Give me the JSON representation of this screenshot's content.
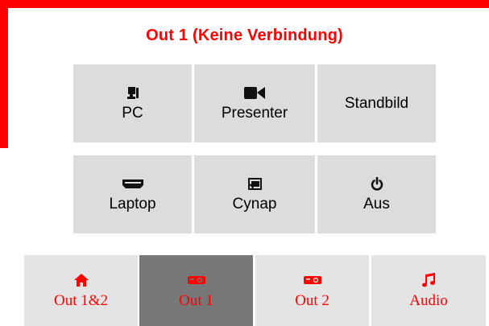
{
  "theme": {
    "accent": "#ff0000",
    "tile_bg": "#dcdcdc",
    "nav_bg": "#e4e4e4",
    "nav_active_bg": "#777777"
  },
  "header": {
    "title": "Out 1 (Keine Verbindung)"
  },
  "sources": [
    {
      "label": "PC",
      "icon": "desktop-computer-icon"
    },
    {
      "label": "Presenter",
      "icon": "video-camera-icon"
    },
    {
      "label": "Standbild",
      "icon": ""
    },
    {
      "label": "Laptop",
      "icon": "hdmi-port-icon"
    },
    {
      "label": "Cynap",
      "icon": "screen-cast-icon"
    },
    {
      "label": "Aus",
      "icon": "power-icon"
    }
  ],
  "nav": [
    {
      "label": "Out 1&2",
      "icon": "home-icon",
      "active": false
    },
    {
      "label": "Out 1",
      "icon": "projector-icon",
      "active": true
    },
    {
      "label": "Out 2",
      "icon": "projector-icon",
      "active": false
    },
    {
      "label": "Audio",
      "icon": "music-note-icon",
      "active": false
    }
  ]
}
